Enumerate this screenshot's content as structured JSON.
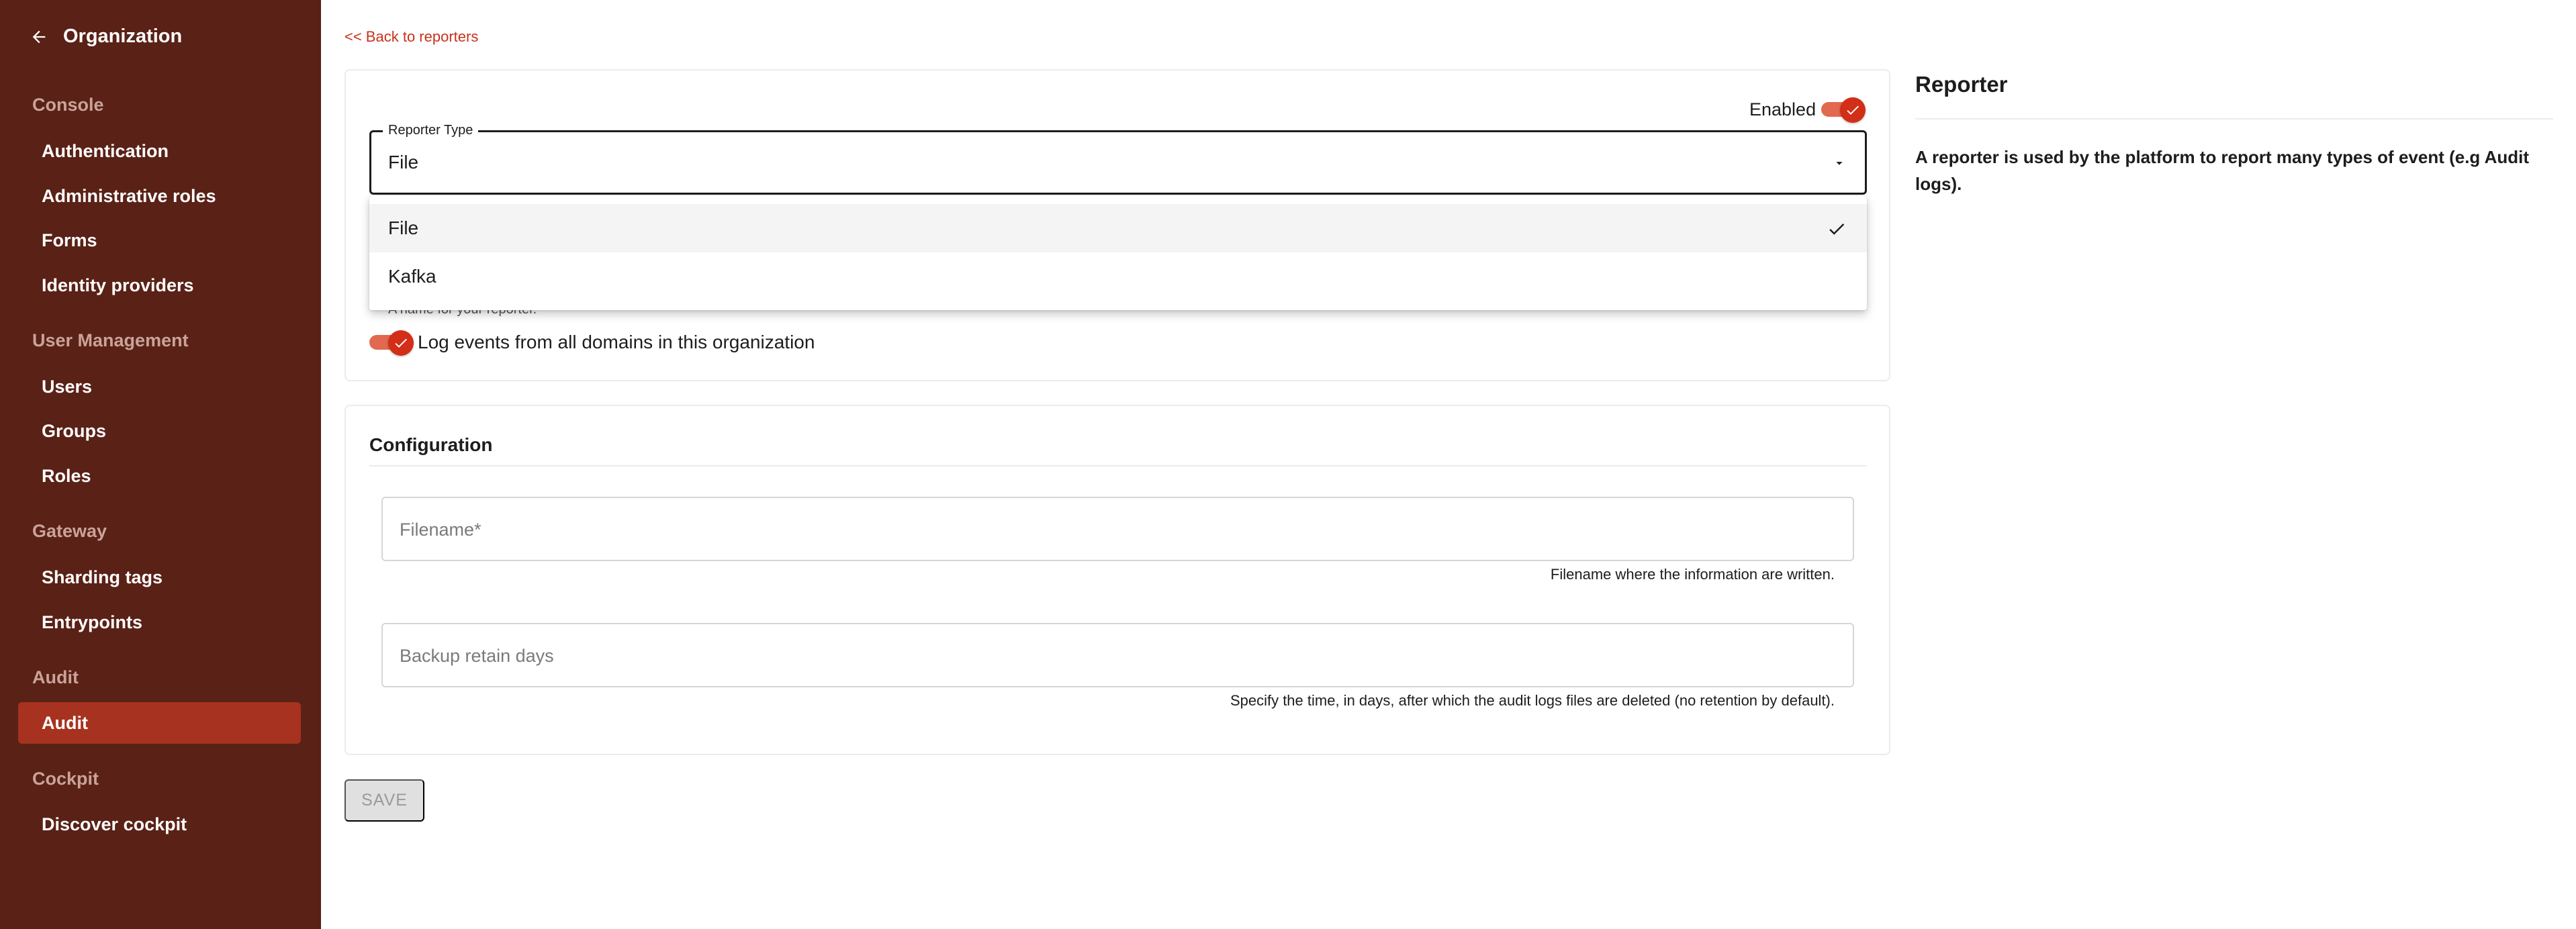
{
  "sidebar": {
    "header": "Organization",
    "sections": [
      {
        "title": "Console",
        "items": [
          "Authentication",
          "Administrative roles",
          "Forms",
          "Identity providers"
        ]
      },
      {
        "title": "User Management",
        "items": [
          "Users",
          "Groups",
          "Roles"
        ]
      },
      {
        "title": "Gateway",
        "items": [
          "Sharding tags",
          "Entrypoints"
        ]
      },
      {
        "title": "Audit",
        "items": [
          "Audit"
        ]
      },
      {
        "title": "Cockpit",
        "items": [
          "Discover cockpit"
        ]
      }
    ],
    "active_item": "Audit"
  },
  "back_link": "<< Back to reporters",
  "general": {
    "enabled_label": "Enabled",
    "enabled": true,
    "reporter_type_label": "Reporter Type",
    "reporter_type_value": "File",
    "reporter_type_options": [
      {
        "label": "File",
        "selected": true
      },
      {
        "label": "Kafka",
        "selected": false
      }
    ],
    "name_hint": "A name for your reporter.",
    "log_all_domains_label": "Log events from all domains in this organization",
    "log_all_domains": true
  },
  "configuration": {
    "title": "Configuration",
    "filename_placeholder": "Filename*",
    "filename_hint": "Filename where the information are written.",
    "retain_placeholder": "Backup retain days",
    "retain_hint": "Specify the time, in days, after which the audit logs files are deleted (no retention by default)."
  },
  "save_label": "SAVE",
  "panel": {
    "title": "Reporter",
    "description": "A reporter is used by the platform to report many types of event (e.g Audit logs)."
  },
  "colors": {
    "sidebar_bg": "#5a2116",
    "accent": "#d32e17",
    "active_item_bg": "#a6321f"
  }
}
